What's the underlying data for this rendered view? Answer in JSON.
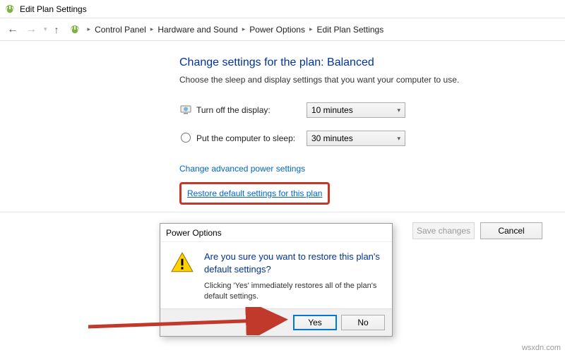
{
  "window": {
    "title": "Edit Plan Settings"
  },
  "nav": {
    "crumbs": [
      "Control Panel",
      "Hardware and Sound",
      "Power Options",
      "Edit Plan Settings"
    ]
  },
  "page": {
    "heading": "Change settings for the plan: Balanced",
    "subtext": "Choose the sleep and display settings that you want your computer to use.",
    "rows": {
      "display": {
        "label": "Turn off the display:",
        "value": "10 minutes"
      },
      "sleep": {
        "label": "Put the computer to sleep:",
        "value": "30 minutes"
      }
    },
    "link_advanced": "Change advanced power settings",
    "link_restore": "Restore default settings for this plan",
    "save": "Save changes",
    "cancel": "Cancel"
  },
  "dialog": {
    "title": "Power Options",
    "main": "Are you sure you want to restore this plan's default settings?",
    "sub": "Clicking 'Yes' immediately restores all of the plan's default settings.",
    "yes": "Yes",
    "no": "No"
  },
  "watermark": "wsxdn.com"
}
